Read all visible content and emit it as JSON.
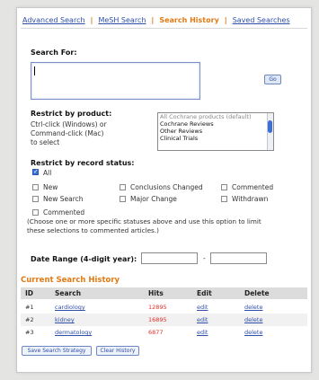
{
  "nav": {
    "items": [
      "Advanced Search",
      "MeSH Search",
      "Search History",
      "Saved Searches"
    ],
    "separator": "|",
    "active_index": 2
  },
  "search": {
    "label": "Search For:",
    "value": "",
    "go_label": "Go"
  },
  "product": {
    "label": "Restrict by product:",
    "help": [
      "Ctrl-click (Windows) or",
      "Command-click (Mac)",
      "to select"
    ],
    "options": [
      "All Cochrane products (default)",
      "Cochrane Reviews",
      "Other Reviews",
      "Clinical Trials"
    ]
  },
  "status": {
    "label": "Restrict by record status:",
    "all_label": "All",
    "all_checked": true,
    "options": [
      "New",
      "Conclusions Changed",
      "Commented",
      "New Search",
      "Major Change",
      "Withdrawn"
    ],
    "commented_label": "Commented",
    "note": [
      "(Choose one or more specific statuses above and use this option to limit",
      "these selections to commented articles.)"
    ]
  },
  "date": {
    "label": "Date Range (4-digit year):",
    "separator": "-",
    "from": "",
    "to": ""
  },
  "history": {
    "title": "Current Search History",
    "headers": [
      "ID",
      "Search",
      "Hits",
      "Edit",
      "Delete"
    ],
    "rows": [
      {
        "id": "#1",
        "search": "cardiology",
        "hits": "12895",
        "edit": "edit",
        "delete": "delete"
      },
      {
        "id": "#2",
        "search": "kidney",
        "hits": "16895",
        "edit": "edit",
        "delete": "delete"
      },
      {
        "id": "#3",
        "search": "dermatology",
        "hits": "6877",
        "edit": "edit",
        "delete": "delete"
      }
    ],
    "row_shading": [
      "#ffffff",
      "#f1f1f1",
      "#ffffff"
    ]
  },
  "buttons": {
    "save": "Save Search Strategy",
    "clear": "Clear History"
  },
  "colors": {
    "link": "#2f4fa8",
    "accent": "#e07a14",
    "hits": "#e0302a"
  }
}
